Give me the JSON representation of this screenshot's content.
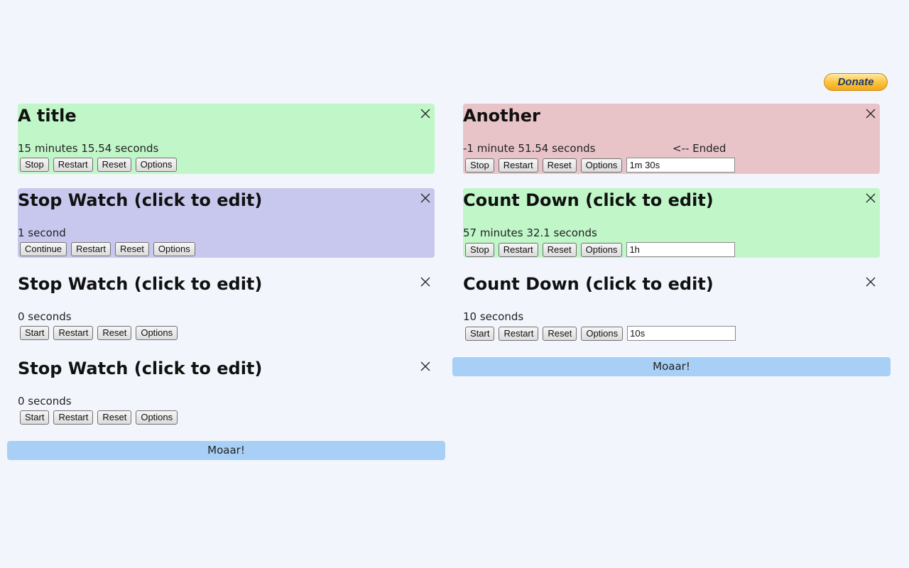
{
  "donate_label": "Donate",
  "columns": {
    "left": {
      "timers": [
        {
          "title": "A title",
          "time": "15 minutes 15.54 seconds",
          "buttons": [
            "Stop",
            "Restart",
            "Reset",
            "Options"
          ],
          "color": "#c0f6c8"
        },
        {
          "title": "Stop Watch (click to edit)",
          "time": "1 second",
          "buttons": [
            "Continue",
            "Restart",
            "Reset",
            "Options"
          ],
          "color": "#c8c8ee"
        },
        {
          "title": "Stop Watch (click to edit)",
          "time": "0 seconds",
          "buttons": [
            "Start",
            "Restart",
            "Reset",
            "Options"
          ],
          "color": "transparent"
        },
        {
          "title": "Stop Watch (click to edit)",
          "time": "0 seconds",
          "buttons": [
            "Start",
            "Restart",
            "Reset",
            "Options"
          ],
          "color": "transparent"
        }
      ],
      "moar_label": "Moaar!"
    },
    "right": {
      "timers": [
        {
          "title": "Another",
          "time": "-1 minute 51.54 seconds",
          "status": "<-- Ended",
          "buttons": [
            "Stop",
            "Restart",
            "Reset",
            "Options"
          ],
          "duration": "1m 30s",
          "color": "#e8c4c9"
        },
        {
          "title": "Count Down (click to edit)",
          "time": "57 minutes 32.1 seconds",
          "buttons": [
            "Stop",
            "Restart",
            "Reset",
            "Options"
          ],
          "duration": "1h",
          "color": "#c0f6c8"
        },
        {
          "title": "Count Down (click to edit)",
          "time": "10 seconds",
          "buttons": [
            "Start",
            "Restart",
            "Reset",
            "Options"
          ],
          "duration": "10s",
          "color": "transparent"
        }
      ],
      "moar_label": "Moaar!"
    }
  },
  "icons": {
    "close": "close-icon"
  }
}
